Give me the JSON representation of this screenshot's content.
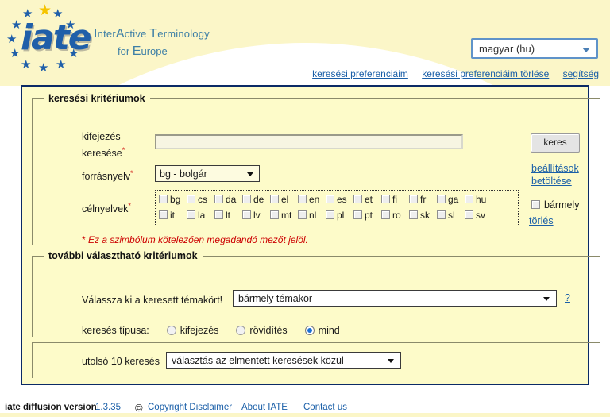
{
  "header": {
    "logo_wordmark": "iate",
    "logo_star_icon": "eu-star",
    "tagline_line1_a": "I",
    "tagline_line1_b": "nter",
    "tagline_line1_c": "A",
    "tagline_line1_d": "ctive ",
    "tagline_line1_e": "T",
    "tagline_line1_f": "erminology",
    "tagline_line2_a": "for ",
    "tagline_line2_b": "E",
    "tagline_line2_c": "urope",
    "language_selector": {
      "value": "magyar (hu)",
      "arrow_icon": "chevron-down-icon"
    },
    "links": [
      {
        "label": "keresési preferenciáim"
      },
      {
        "label": "keresési preferenciáim törlése"
      },
      {
        "label": "segítség"
      }
    ]
  },
  "search_criteria": {
    "legend": "keresési kritériumok",
    "term_label_line1": "kifejezés",
    "term_label_line2": "keresése",
    "term_required_mark": "*",
    "term_input_value": "",
    "term_input_placeholder": "",
    "search_button": "keres",
    "source_label": "forrásnyelv",
    "source_required_mark": "*",
    "source_value": "bg - bolgár",
    "load_settings_line1": "beállítások",
    "load_settings_line2": "betöltése",
    "target_label": "célnyelvek",
    "target_required_mark": "*",
    "target_languages_row1": [
      "bg",
      "cs",
      "da",
      "de",
      "el",
      "en",
      "es",
      "et",
      "fi",
      "fr",
      "ga",
      "hu"
    ],
    "target_languages_row2": [
      "it",
      "la",
      "lt",
      "lv",
      "mt",
      "nl",
      "pl",
      "pt",
      "ro",
      "sk",
      "sl",
      "sv"
    ],
    "any_label": "bármely",
    "clear_label": "törlés",
    "required_note_asterisk": "*",
    "required_note": "Ez a szimbólum kötelezően megadandó mezőt jelöl."
  },
  "additional_criteria": {
    "legend": "további választható kritériumok",
    "domain_label": "Válassza ki a keresett témakört!",
    "domain_value": "bármely témakör",
    "domain_help": "?",
    "search_type_label": "keresés típusa:",
    "search_type_options": [
      {
        "label": "kifejezés",
        "selected": false
      },
      {
        "label": "rövidítés",
        "selected": false
      },
      {
        "label": "mind",
        "selected": true
      }
    ]
  },
  "recent_searches": {
    "label": "utolsó 10 keresés",
    "value": "választás az elmentett keresések közül"
  },
  "footer": {
    "app_name": "iate diffusion version",
    "version": "1.3.35",
    "copyright_icon": "©",
    "copyright_link": "Copyright Disclaimer",
    "about_link": "About IATE",
    "contact_link": "Contact us"
  },
  "colors": {
    "header_band": "#fbf6c8",
    "panel_bg": "#fdfbc9",
    "panel_border": "#0b2a66",
    "link": "#1a5fa8",
    "required": "#cc0000",
    "logo_blue": "#1f5fa9",
    "logo_gold": "#f5c400",
    "radio_selected": "#1a6fd4"
  }
}
